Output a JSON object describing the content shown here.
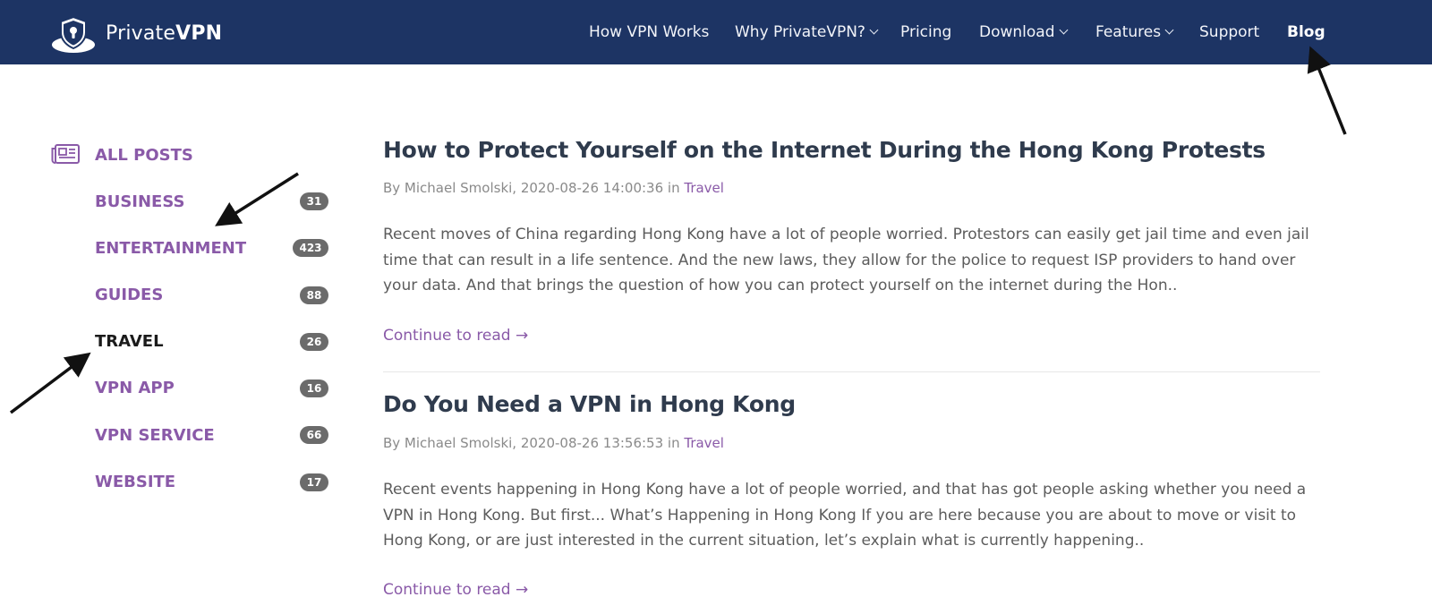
{
  "brand": {
    "name_light": "Private",
    "name_bold": "VPN"
  },
  "nav": [
    {
      "label": "How VPN Works",
      "dropdown": false,
      "active": false
    },
    {
      "label": "Why PrivateVPN?",
      "dropdown": true,
      "active": false
    },
    {
      "label": "Pricing",
      "dropdown": false,
      "active": false
    },
    {
      "label": "Download",
      "dropdown": true,
      "active": false
    },
    {
      "label": "Features",
      "dropdown": true,
      "active": false
    },
    {
      "label": "Support",
      "dropdown": false,
      "active": false
    },
    {
      "label": "Blog",
      "dropdown": false,
      "active": true
    }
  ],
  "sidebar": {
    "all_posts": "ALL POSTS",
    "categories": [
      {
        "label": "BUSINESS",
        "count": "31",
        "active": false
      },
      {
        "label": "ENTERTAINMENT",
        "count": "423",
        "active": false
      },
      {
        "label": "GUIDES",
        "count": "88",
        "active": false
      },
      {
        "label": "TRAVEL",
        "count": "26",
        "active": true
      },
      {
        "label": "VPN APP",
        "count": "16",
        "active": false
      },
      {
        "label": "VPN SERVICE",
        "count": "66",
        "active": false
      },
      {
        "label": "WEBSITE",
        "count": "17",
        "active": false
      }
    ]
  },
  "posts": [
    {
      "title": "How to Protect Yourself on the Internet During the Hong Kong Protests",
      "meta_prefix": "By Michael Smolski, 2020-08-26 14:00:36 in ",
      "category": "Travel",
      "excerpt": "Recent moves of China regarding Hong Kong have a lot of people worried. Protestors can easily get jail time and even jail time that can result in a life sentence. And the new laws, they allow for the police to request ISP providers to hand over your data. And that brings the question of how you can protect yourself on the internet during the Hon..",
      "more": "Continue to read →"
    },
    {
      "title": "Do You Need a VPN in Hong Kong",
      "meta_prefix": "By Michael Smolski, 2020-08-26 13:56:53 in ",
      "category": "Travel",
      "excerpt": "Recent events happening in Hong Kong have a lot of people worried, and that has got people asking whether you need a VPN in Hong Kong. But first... What’s Happening in Hong Kong If you are here because you are about to move or visit to Hong Kong, or are just interested in the current situation, let’s explain what is currently happening..",
      "more": "Continue to read →"
    }
  ],
  "colors": {
    "header_bg": "#1d3464",
    "accent_purple": "#8a5aa8",
    "badge_bg": "#6b6b6b"
  }
}
